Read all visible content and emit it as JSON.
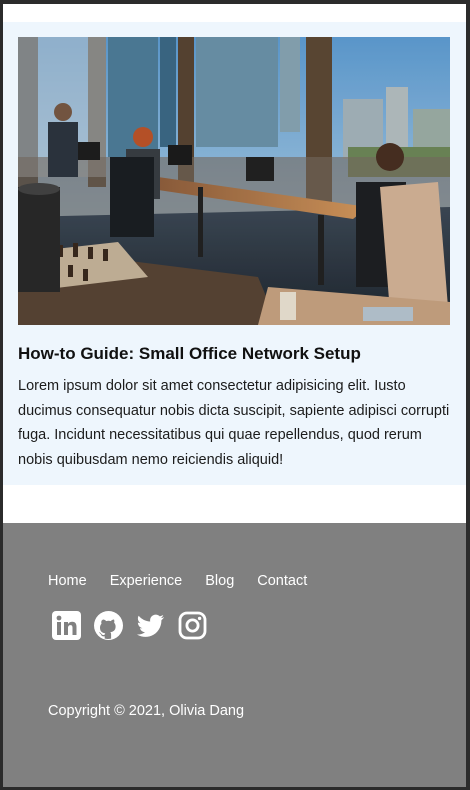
{
  "article": {
    "image_alt": "Open-plan office with people working at desks by tall windows overlooking a city",
    "title": "How-to Guide: Small Office Network Setup",
    "body": "Lorem ipsum dolor sit amet consectetur adipisicing elit. Iusto ducimus consequatur nobis dicta suscipit, sapiente adipisci corrupti fuga. Incidunt necessitatibus qui quae repellendus, quod rerum nobis quibusdam nemo reiciendis aliquid!"
  },
  "footer": {
    "nav": [
      "Home",
      "Experience",
      "Blog",
      "Contact"
    ],
    "social_icons": [
      "linkedin-icon",
      "github-icon",
      "twitter-icon",
      "instagram-icon"
    ],
    "copyright": "Copyright © 2021, Olivia Dang"
  },
  "colors": {
    "card_background": "#eef6fd",
    "footer_background": "#808080",
    "footer_text": "#ffffff"
  }
}
